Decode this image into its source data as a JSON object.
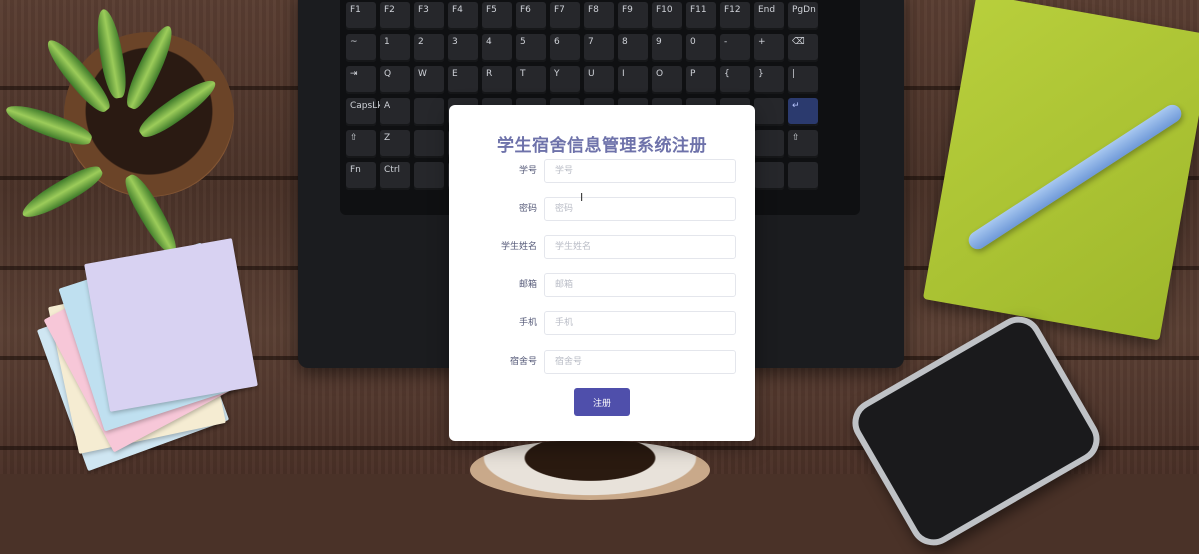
{
  "form": {
    "title": "学生宿舍信息管理系统注册",
    "fields": [
      {
        "label": "学号",
        "placeholder": "学号",
        "value": ""
      },
      {
        "label": "密码",
        "placeholder": "密码",
        "value": ""
      },
      {
        "label": "学生姓名",
        "placeholder": "学生姓名",
        "value": ""
      },
      {
        "label": "邮箱",
        "placeholder": "邮箱",
        "value": ""
      },
      {
        "label": "手机",
        "placeholder": "手机",
        "value": ""
      },
      {
        "label": "宿舍号",
        "placeholder": "宿舍号",
        "value": ""
      }
    ],
    "submit_label": "注册"
  },
  "keyboard": {
    "rows": [
      [
        "F1",
        "F2",
        "F3",
        "F4",
        "F5",
        "F6",
        "F7",
        "F8",
        "F9",
        "F10",
        "F11",
        "F12",
        "End",
        "PgDn"
      ],
      [
        "~",
        "1",
        "2",
        "3",
        "4",
        "5",
        "6",
        "7",
        "8",
        "9",
        "0",
        "-",
        "+",
        "⌫"
      ],
      [
        "⇥",
        "Q",
        "W",
        "E",
        "R",
        "T",
        "Y",
        "U",
        "I",
        "O",
        "P",
        "{",
        "}",
        "|"
      ],
      [
        "CapsLk",
        "A",
        "",
        "",
        "",
        "",
        "",
        "",
        "",
        "",
        "",
        "",
        "",
        "↵"
      ],
      [
        "⇧",
        "Z",
        "",
        "",
        "",
        "",
        "",
        "",
        "",
        "",
        "",
        "",
        "",
        "⇧"
      ],
      [
        "Fn",
        "Ctrl",
        "",
        "",
        "",
        "",
        "",
        "",
        "",
        "",
        "",
        "",
        "",
        ""
      ]
    ]
  },
  "colors": {
    "accent": "#4f4fab",
    "title": "#6e72aa"
  }
}
